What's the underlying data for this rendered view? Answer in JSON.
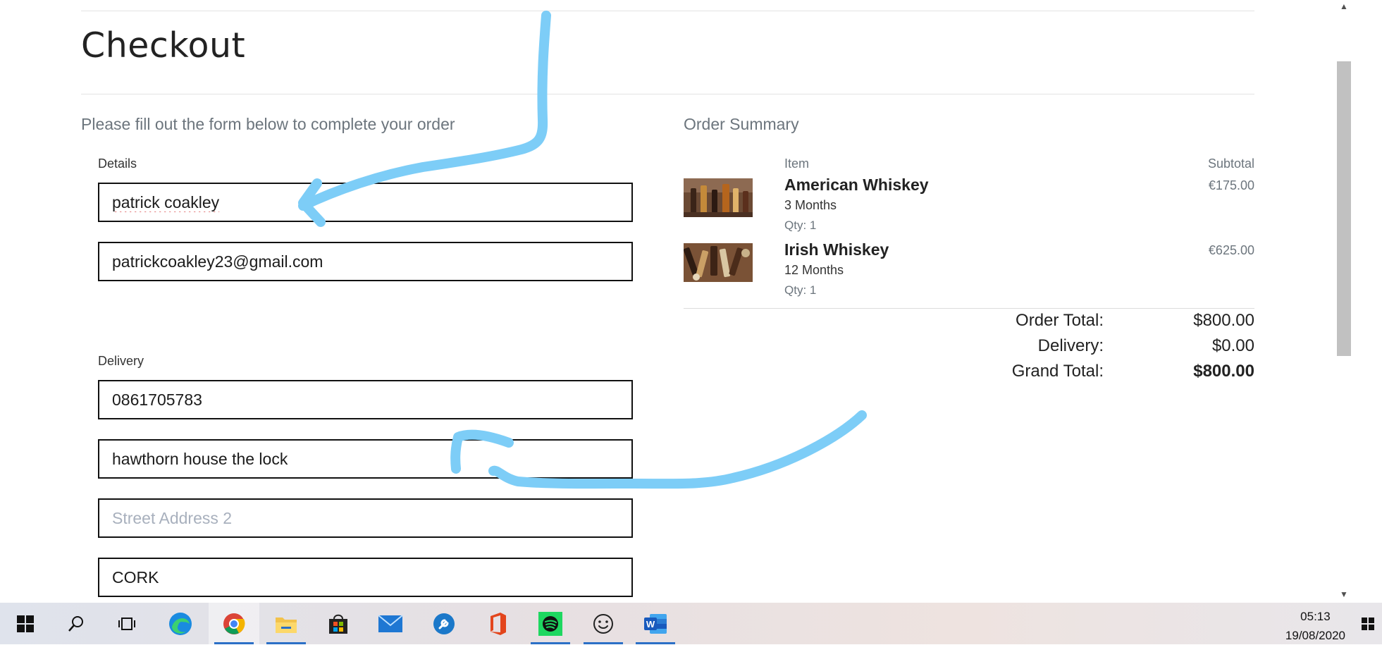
{
  "page": {
    "title": "Checkout",
    "lead": "Please fill out the form below to complete your order"
  },
  "form": {
    "details_label": "Details",
    "full_name": "patrick coakley",
    "email": "patrickcoakley23@gmail.com",
    "delivery_label": "Delivery",
    "phone": "0861705783",
    "street1": "hawthorn house the lock",
    "street2_placeholder": "Street Address 2",
    "town": "CORK"
  },
  "summary": {
    "title": "Order Summary",
    "col_item": "Item",
    "col_subtotal": "Subtotal",
    "items": [
      {
        "name": "American Whiskey",
        "term": "3 Months",
        "qty": "Qty: 1",
        "subtotal": "€175.00"
      },
      {
        "name": "Irish Whiskey",
        "term": "12 Months",
        "qty": "Qty: 1",
        "subtotal": "€625.00"
      }
    ],
    "order_total_label": "Order Total:",
    "order_total": "$800.00",
    "delivery_label": "Delivery:",
    "delivery": "$0.00",
    "grand_total_label": "Grand Total:",
    "grand_total": "$800.00"
  },
  "taskbar": {
    "icons": [
      "windows-start-icon",
      "search-icon",
      "task-view-icon",
      "edge-icon",
      "chrome-icon",
      "file-explorer-icon",
      "store-icon",
      "mail-icon",
      "settings-tool-icon",
      "office-icon",
      "spotify-icon",
      "emoji-app-icon",
      "word-icon"
    ],
    "time": "05:13",
    "date": "19/08/2020"
  },
  "colors": {
    "annotation_stroke": "#7dcdf7",
    "field_border": "#111111",
    "muted_text": "#6c757d",
    "taskbar_accent": "#2b6fc6"
  }
}
